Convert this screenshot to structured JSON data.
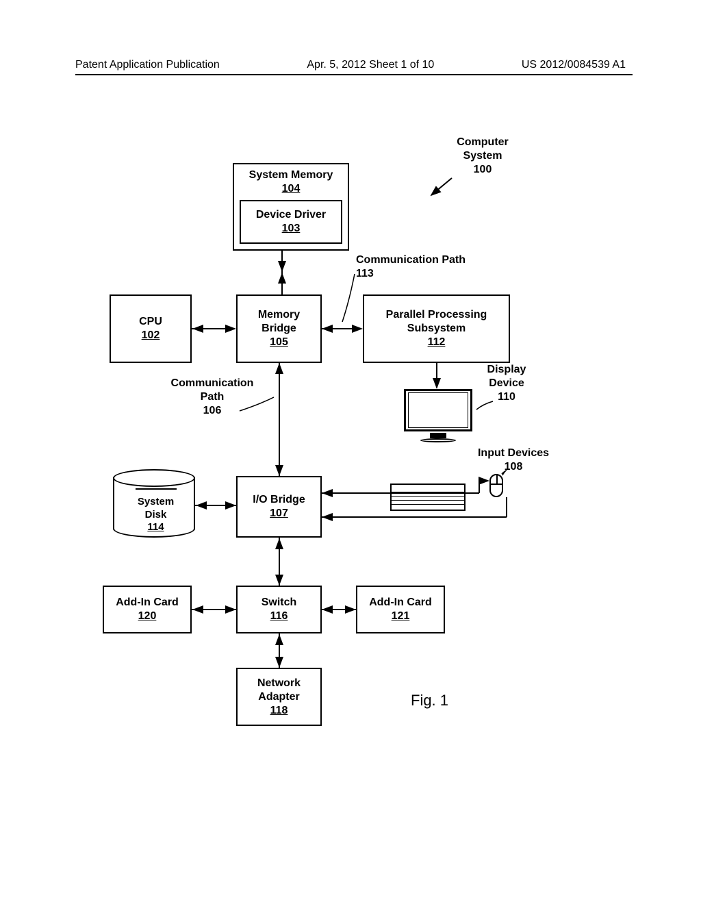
{
  "header": {
    "left": "Patent Application Publication",
    "middle": "Apr. 5, 2012  Sheet 1 of 10",
    "right": "US 2012/0084539 A1"
  },
  "labels": {
    "computer_system": "Computer\nSystem\n100",
    "comm_path_113": "Communication Path\n113",
    "comm_path_106": "Communication\nPath\n106",
    "display_device": "Display\nDevice\n110",
    "input_devices": "Input Devices\n108"
  },
  "boxes": {
    "system_memory": {
      "title": "System Memory",
      "num": "104"
    },
    "device_driver": {
      "title": "Device Driver",
      "num": "103"
    },
    "cpu": {
      "title": "CPU",
      "num": "102"
    },
    "memory_bridge": {
      "title": "Memory\nBridge",
      "num": "105"
    },
    "pps": {
      "title": "Parallel Processing\nSubsystem",
      "num": "112"
    },
    "io_bridge": {
      "title": "I/O Bridge",
      "num": "107"
    },
    "system_disk": {
      "title": "System\nDisk",
      "num": "114"
    },
    "addin_120": {
      "title": "Add-In Card",
      "num": "120"
    },
    "switch": {
      "title": "Switch",
      "num": "116"
    },
    "addin_121": {
      "title": "Add-In Card",
      "num": "121"
    },
    "network_adapter": {
      "title": "Network\nAdapter",
      "num": "118"
    }
  },
  "figure": "Fig. 1"
}
